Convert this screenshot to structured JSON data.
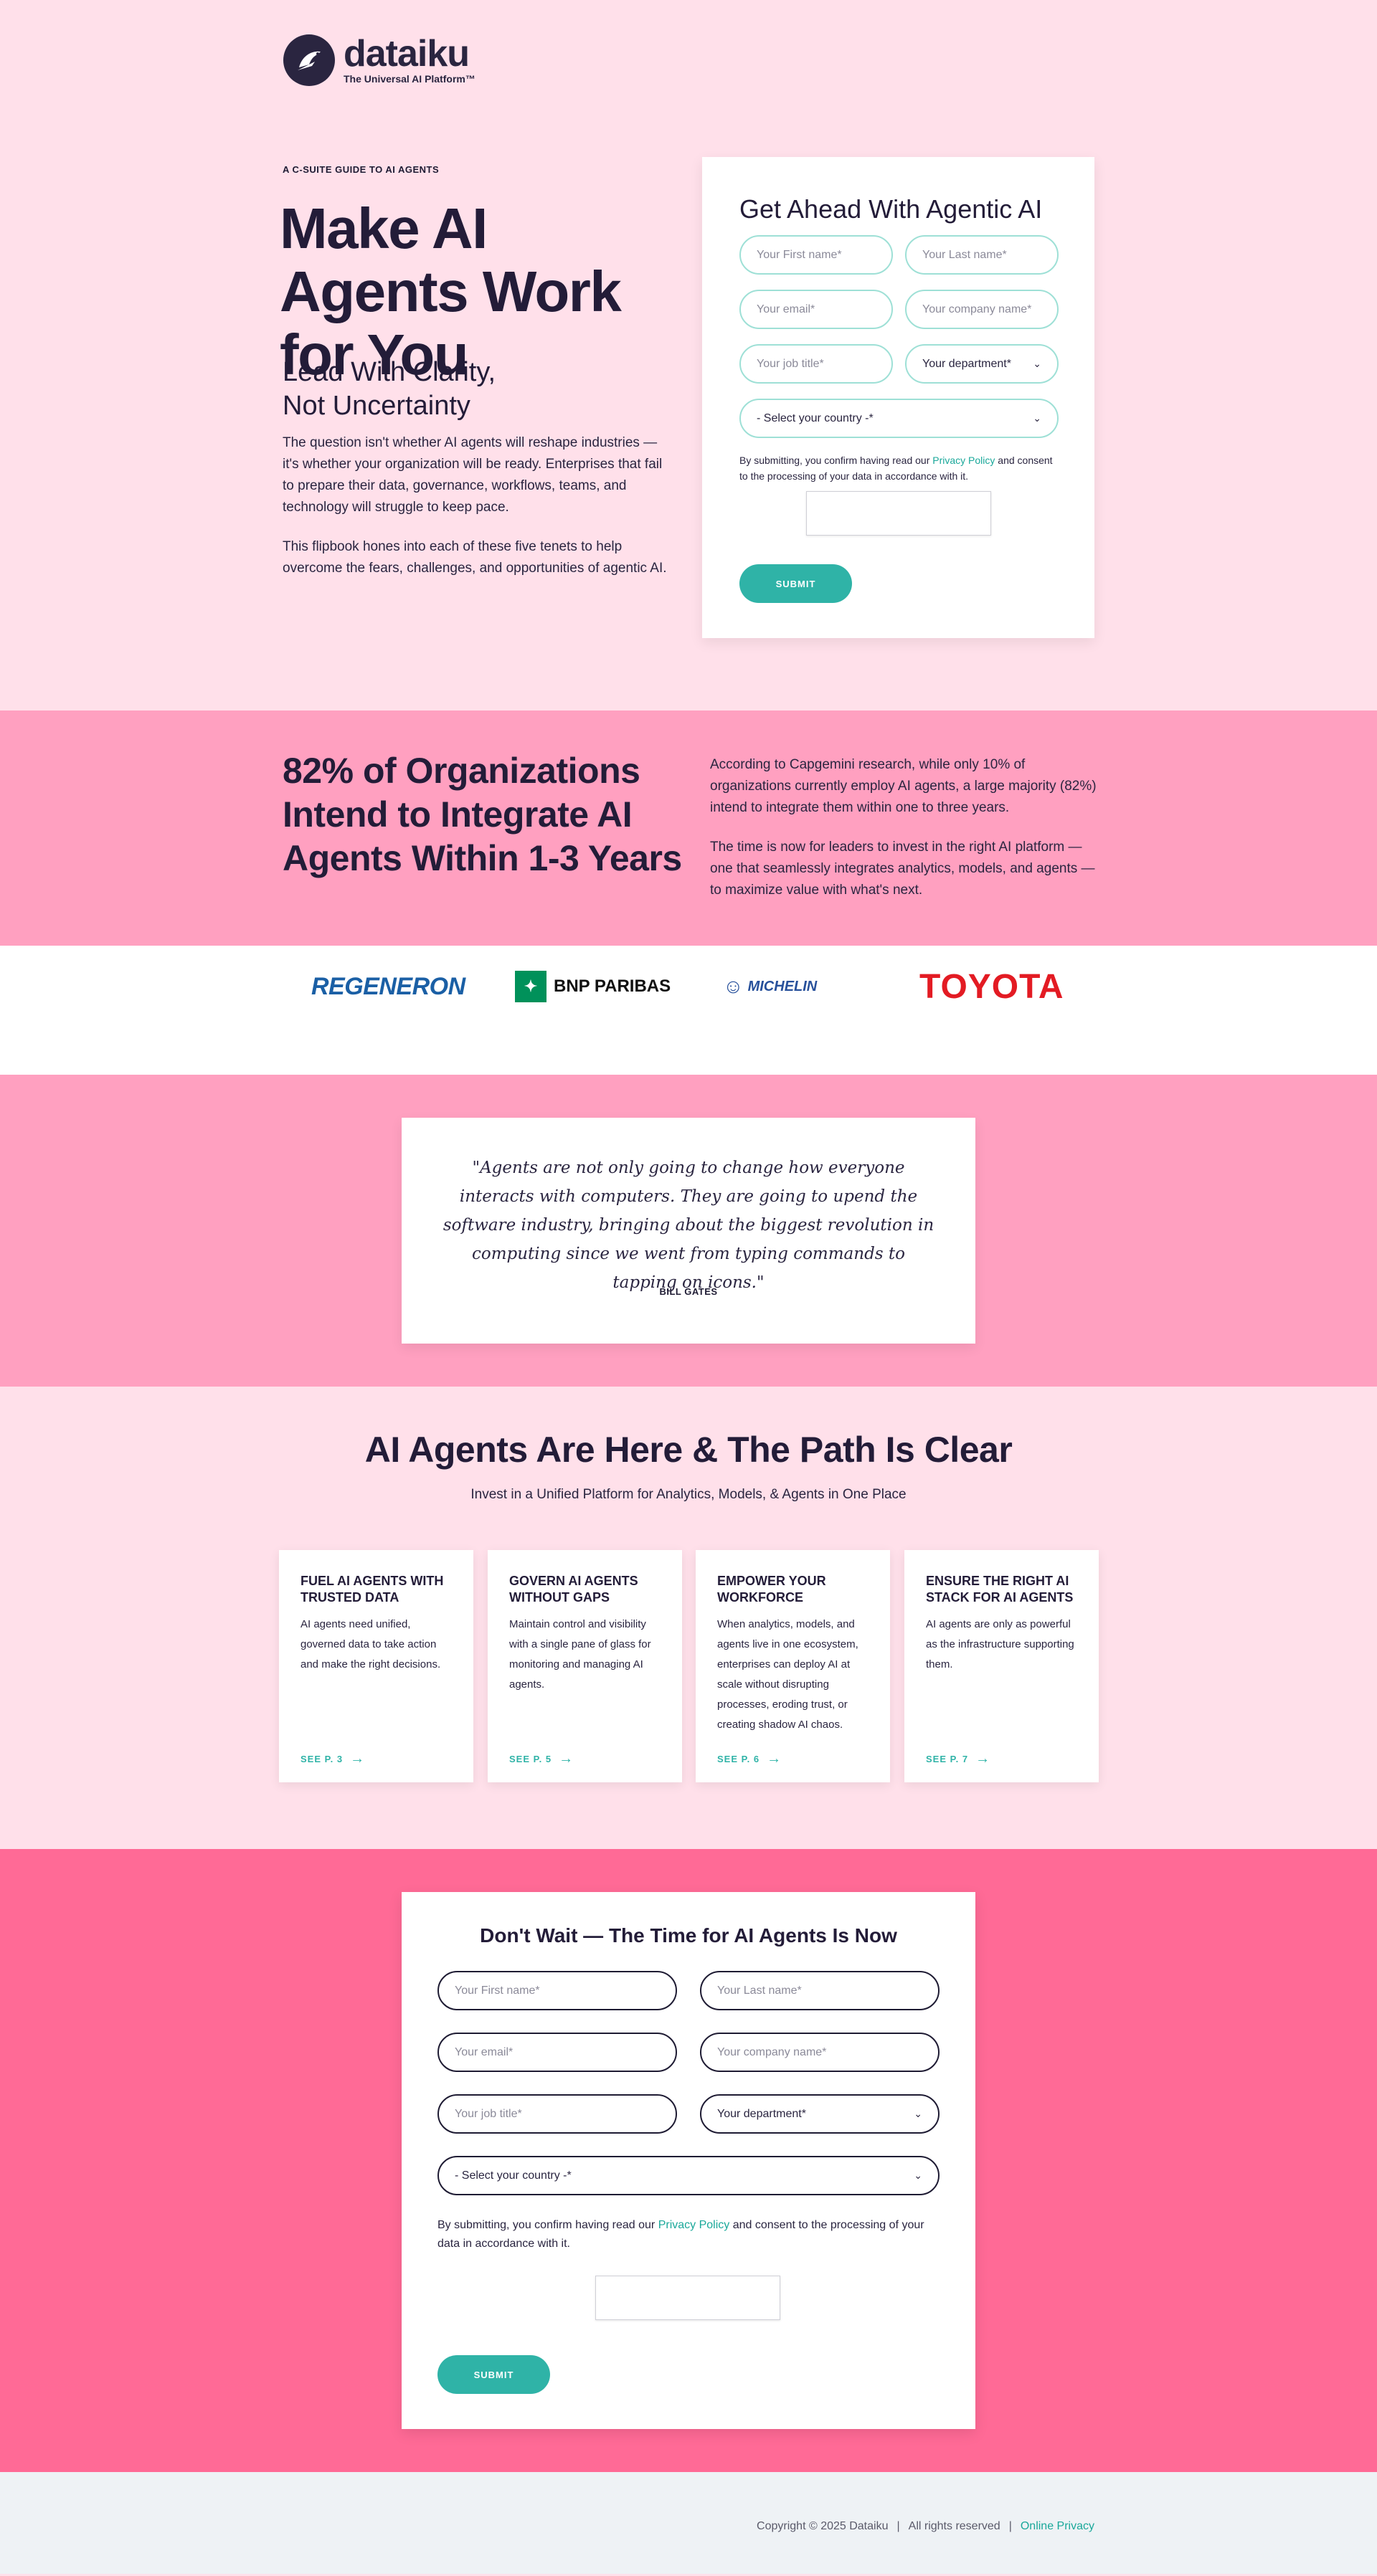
{
  "brand": {
    "name": "dataiku",
    "tagline": "The Universal AI Platform™"
  },
  "hero": {
    "eyebrow": "A C-SUITE GUIDE TO AI AGENTS",
    "title": "Make AI Agents Work for You",
    "subtitle_line1": "Lead With Clarity,",
    "subtitle_line2": "Not Uncertainty",
    "paragraph1": "The question isn't whether AI agents will reshape industries — it's whether your organization will be ready. Enterprises that fail to prepare their data, governance, workflows, teams, and technology will struggle to keep pace.",
    "paragraph2": "This flipbook hones into each of these five tenets to help overcome the fears, challenges, and opportunities of agentic AI."
  },
  "form_top": {
    "title": "Get Ahead With Agentic AI",
    "first_name": "Your First name*",
    "last_name": "Your Last name*",
    "email": "Your email*",
    "company": "Your company name*",
    "job_title": "Your job title*",
    "department": "Your department*",
    "country": "- Select your country -*",
    "policy_before": "By submitting, you confirm having read our ",
    "policy_link": "Privacy Policy",
    "policy_after": " and consent to the processing of your data in accordance with it.",
    "submit": "SUBMIT"
  },
  "stat": {
    "title": "82% of Organizations Intend to Integrate AI Agents Within 1-3 Years",
    "paragraph1": "According to Capgemini research, while only 10% of organizations currently employ AI agents, a large majority (82%) intend to integrate them within one to three years.",
    "paragraph2": "The time is now for leaders to invest in the right AI platform — one that seamlessly integrates analytics, models, and agents — to maximize value with what's next."
  },
  "logos": {
    "regeneron": "REGENERON",
    "bnp": "BNP PARIBAS",
    "michelin": "MICHELIN",
    "toyota": "TOYOTA"
  },
  "quote": {
    "text": "\"Agents are not only going to change how everyone interacts with computers. They are going to upend the software industry, bringing about the biggest revolution in computing since we went from typing commands to tapping on icons.\"",
    "author": "BILL GATES"
  },
  "path": {
    "title": "AI Agents Are Here & The Path Is Clear",
    "subtitle": "Invest in a Unified Platform for Analytics, Models, & Agents in One Place",
    "cards": [
      {
        "title": "FUEL AI AGENTS WITH TRUSTED DATA",
        "body": "AI agents need unified, governed data to take action and make the right decisions.",
        "link": "SEE P. 3"
      },
      {
        "title": "GOVERN AI AGENTS WITHOUT GAPS",
        "body": "Maintain control and visibility with a single pane of glass for monitoring and managing AI agents.",
        "link": "SEE P. 5"
      },
      {
        "title": "EMPOWER YOUR WORKFORCE",
        "body": "When analytics, models, and agents live in one ecosystem, enterprises can deploy AI at scale without disrupting processes, eroding trust, or creating shadow AI chaos.",
        "link": "SEE P. 6"
      },
      {
        "title": "ENSURE THE RIGHT AI STACK FOR AI AGENTS",
        "body": "AI agents are only as powerful as the infrastructure supporting them.",
        "link": "SEE P. 7"
      }
    ]
  },
  "form_bottom": {
    "title": "Don't Wait — The Time for AI Agents Is Now",
    "first_name": "Your First name*",
    "last_name": "Your Last name*",
    "email": "Your email*",
    "company": "Your company name*",
    "job_title": "Your job title*",
    "department": "Your department*",
    "country": "- Select your country -*",
    "policy_before": "By submitting, you confirm having read our ",
    "policy_link": "Privacy Policy",
    "policy_after": " and consent to the processing of your data in accordance with it.",
    "submit": "SUBMIT"
  },
  "footer": {
    "copyright": "Copyright © 2025 Dataiku",
    "sep1": "|",
    "rights": "All rights reserved",
    "sep2": "|",
    "privacy": "Online Privacy"
  },
  "colors": {
    "hero_bg": "#ffe0ea",
    "stat_bg": "#ffa0c0",
    "cta_bg": "#ff6a96",
    "accent_teal": "#2fb3a7",
    "ink": "#231c38"
  }
}
